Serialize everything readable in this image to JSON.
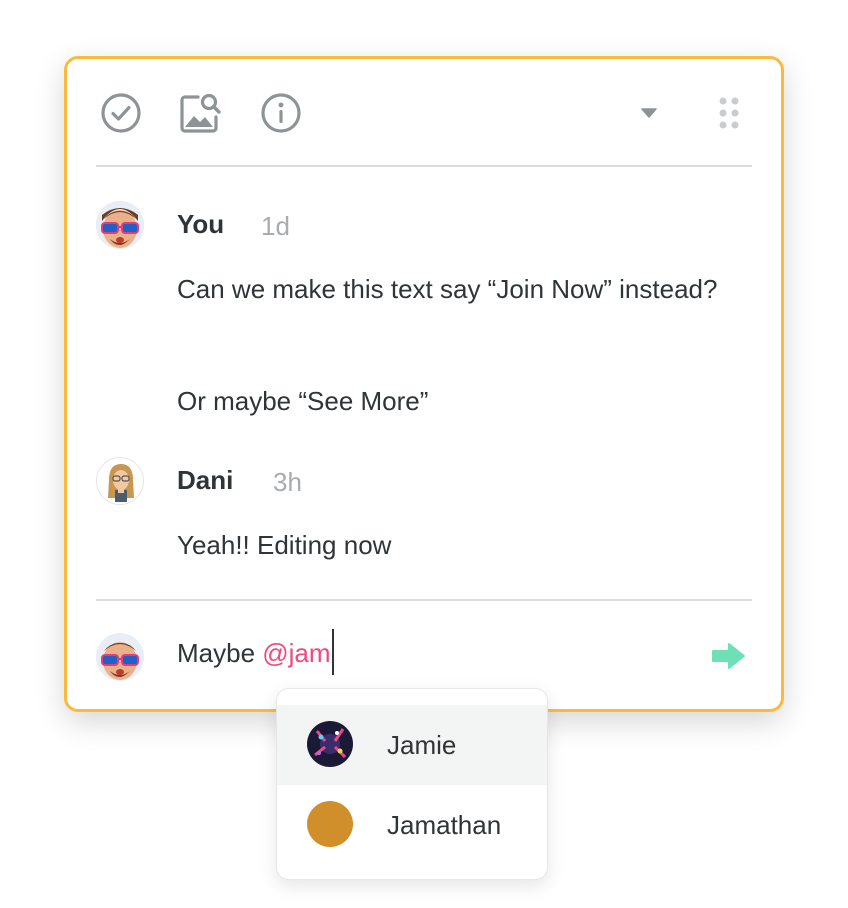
{
  "colors": {
    "card_border": "#f9bb3f",
    "mention": "#f2487c",
    "send_arrow": "#6fe0b5",
    "icon_gray": "#8e9396",
    "jamathan_avatar": "#d18f2c"
  },
  "toolbar": {
    "icons": [
      "check-circle-icon",
      "image-search-icon",
      "info-icon",
      "caret-down-icon",
      "drag-handle-icon"
    ]
  },
  "comments": [
    {
      "author": "You",
      "time": "1d",
      "messages": [
        "Can we make this text say “Join Now” instead?",
        "Or maybe “See More”"
      ]
    },
    {
      "author": "Dani",
      "time": "3h",
      "messages": [
        "Yeah!! Editing now"
      ]
    }
  ],
  "composer": {
    "text": "Maybe ",
    "mention": "@jam"
  },
  "mention_suggestions": [
    {
      "name": "Jamie",
      "highlighted": true
    },
    {
      "name": "Jamathan",
      "highlighted": false
    }
  ]
}
